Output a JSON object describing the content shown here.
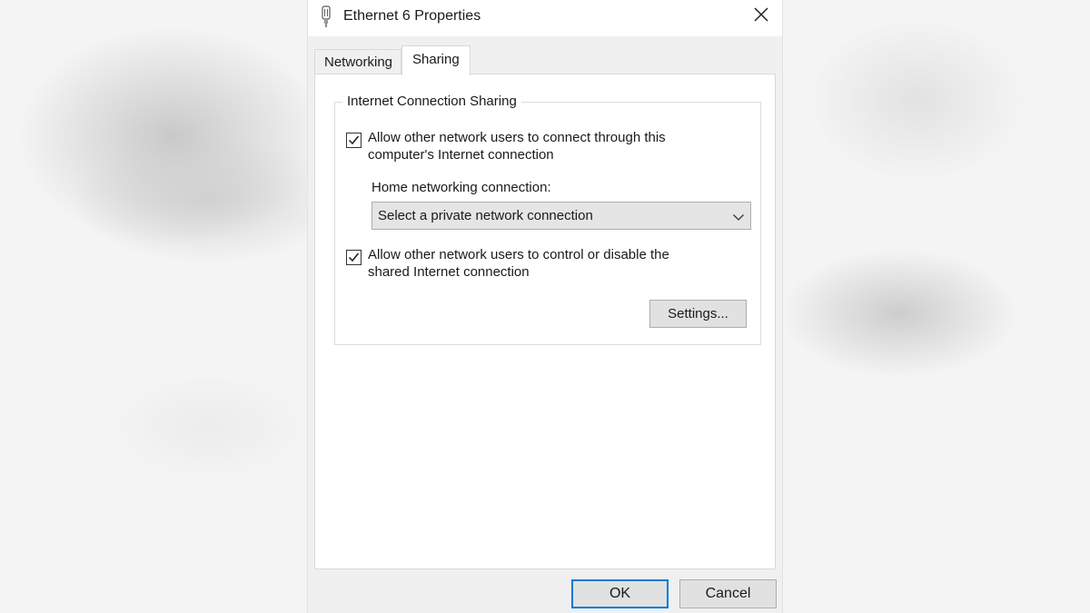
{
  "window": {
    "title": "Ethernet 6 Properties",
    "icon": "ethernet-adapter-icon",
    "close_icon": "close-icon"
  },
  "tabs": [
    {
      "label": "Networking",
      "selected": false
    },
    {
      "label": "Sharing",
      "selected": true
    }
  ],
  "sharing": {
    "group_title": "Internet Connection Sharing",
    "allow_connect": {
      "checked": true,
      "line1": "Allow other network users to connect through this",
      "line2": "computer's Internet connection"
    },
    "home_network": {
      "label": "Home networking connection:",
      "selected_value": "Select a private network connection"
    },
    "allow_control": {
      "checked": true,
      "line1": "Allow other network users to control or disable the",
      "line2": "shared Internet connection"
    },
    "settings_button": "Settings..."
  },
  "footer": {
    "ok_label": "OK",
    "cancel_label": "Cancel"
  },
  "colors": {
    "accent": "#0078d7",
    "button_face": "#e1e1e1",
    "dialog_background": "#f0f0f0"
  }
}
